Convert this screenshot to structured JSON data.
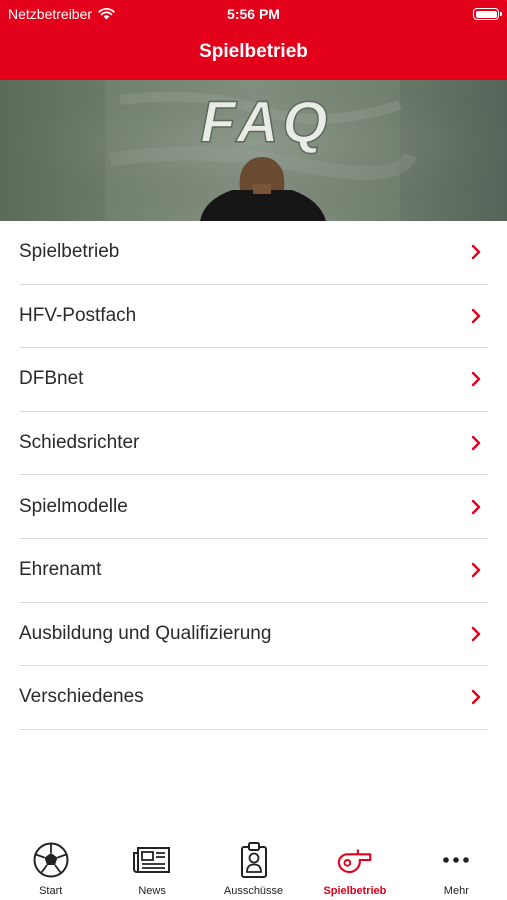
{
  "status_bar": {
    "carrier": "Netzbetreiber",
    "time": "5:56 PM"
  },
  "header": {
    "title": "Spielbetrieb"
  },
  "hero": {
    "board_text": "FAQ"
  },
  "menu": {
    "items": [
      {
        "label": "Spielbetrieb"
      },
      {
        "label": "HFV-Postfach"
      },
      {
        "label": "DFBnet"
      },
      {
        "label": "Schiedsrichter"
      },
      {
        "label": "Spielmodelle"
      },
      {
        "label": "Ehrenamt"
      },
      {
        "label": "Ausbildung und Qualifizierung"
      },
      {
        "label": "Verschiedenes"
      }
    ]
  },
  "tab_bar": {
    "tabs": [
      {
        "label": "Start",
        "icon": "soccer-ball-icon",
        "active": false
      },
      {
        "label": "News",
        "icon": "newspaper-icon",
        "active": false
      },
      {
        "label": "Ausschüsse",
        "icon": "id-badge-icon",
        "active": false
      },
      {
        "label": "Spielbetrieb",
        "icon": "whistle-icon",
        "active": true
      },
      {
        "label": "Mehr",
        "icon": "more-dots-icon",
        "active": false
      }
    ]
  },
  "colors": {
    "accent": "#e2001a",
    "divider": "#dcdcdc",
    "text": "#2a2a2a"
  }
}
